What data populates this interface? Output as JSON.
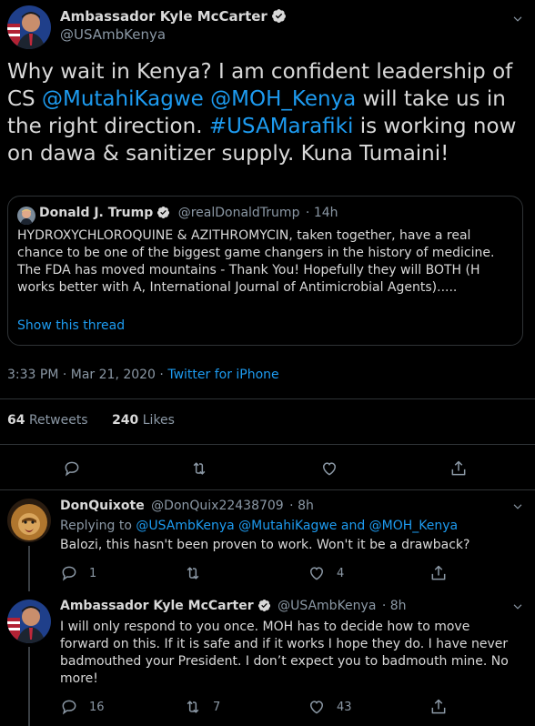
{
  "main_tweet": {
    "author_name": "Ambassador Kyle McCarter",
    "author_handle": "@USAmbKenya",
    "text_part1": "Why wait in Kenya? I am confident leadership of CS ",
    "mention1": "@MutahiKagwe",
    "text_space": " ",
    "mention2": "@MOH_Kenya",
    "text_part2": " will take us in the right direction. ",
    "hashtag": "#USAMarafiki",
    "text_part3": " is working now on dawa & sanitizer supply. Kuna Tumaini!",
    "time": "3:33 PM · Mar 21, 2020 · ",
    "source": "Twitter for iPhone",
    "retweet_count": "64",
    "retweet_label": "Retweets",
    "like_count": "240",
    "like_label": "Likes"
  },
  "quoted_tweet": {
    "author_name": "Donald J. Trump",
    "author_handle": "@realDonaldTrump",
    "time": "· 14h",
    "text": "HYDROXYCHLOROQUINE & AZITHROMYCIN, taken together, have a real chance to be one of the biggest game changers in the history of medicine. The FDA has moved mountains - Thank You! Hopefully they will BOTH (H works better with A, International Journal of Antimicrobial Agents).....",
    "show_thread": "Show this thread"
  },
  "replies": [
    {
      "author_name": "DonQuixote",
      "author_handle": "@DonQuix22438709",
      "time": "· 8h",
      "replying_prefix": "Replying to ",
      "replying_to": "@USAmbKenya @MutahiKagwe",
      "replying_and": " and ",
      "replying_last": "@MOH_Kenya",
      "text": "Balozi, this hasn't been proven to work. Won't it be a drawback?",
      "reply_count": "1",
      "retweet_count": "",
      "like_count": "4"
    },
    {
      "author_name": "Ambassador Kyle McCarter",
      "author_handle": "@USAmbKenya",
      "time": "· 8h",
      "text": "I will only respond to you once. MOH has to decide how to move forward on this. If it is safe and if it works I hope they do. I have never badmouthed your President. I don’t expect you to badmouth mine. No more!",
      "reply_count": "16",
      "retweet_count": "7",
      "like_count": "43"
    }
  ],
  "colors": {
    "background": "#000000",
    "text": "#d9d9d9",
    "muted": "#8b98a5",
    "link": "#1d9bf0",
    "verified": "#d9d9d9"
  },
  "icons": {
    "reply": "reply-icon",
    "retweet": "retweet-icon",
    "like": "heart-icon",
    "share": "share-icon",
    "verified": "verified-badge-icon",
    "chevron": "chevron-down-icon"
  }
}
